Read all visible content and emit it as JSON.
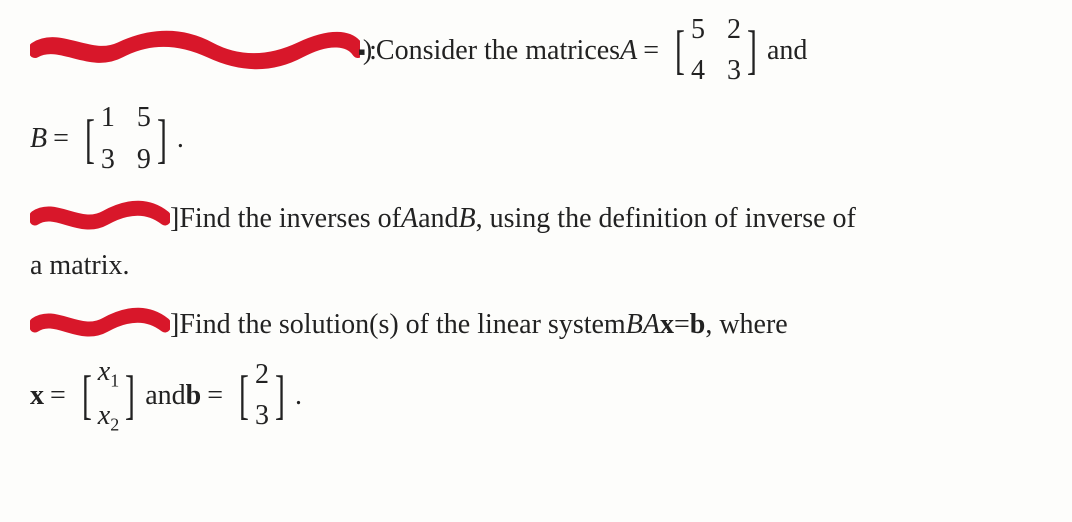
{
  "line1": {
    "suffix_paren": "):",
    "text1": " Consider the matrices ",
    "A_label": "A",
    "eq": " = ",
    "A": [
      [
        "5",
        "2"
      ],
      [
        "4",
        "3"
      ]
    ],
    "and": " and"
  },
  "line2": {
    "B_label": "B",
    "eq": " = ",
    "B": [
      [
        "1",
        "5"
      ],
      [
        "3",
        "9"
      ]
    ],
    "dot": "."
  },
  "line3": {
    "bracket_close": "]",
    "text": " Find the inverses of ",
    "A": "A",
    "and": " and ",
    "B": "B",
    "rest": ", using the definition of inverse of"
  },
  "line4": {
    "text": "a matrix."
  },
  "line5": {
    "bracket_close": "]",
    "text1": " Find the solution(s) of the linear system ",
    "BA": "BA",
    "x": "x",
    "eq": " = ",
    "b": "b",
    "where": ", where"
  },
  "line6": {
    "x_label": "x",
    "eq1": " = ",
    "xvec": [
      "x",
      "x"
    ],
    "xsubs": [
      "1",
      "2"
    ],
    "and": " and ",
    "b_label": "b",
    "eq2": " = ",
    "bvec": [
      "2",
      "3"
    ],
    "dot": "."
  }
}
